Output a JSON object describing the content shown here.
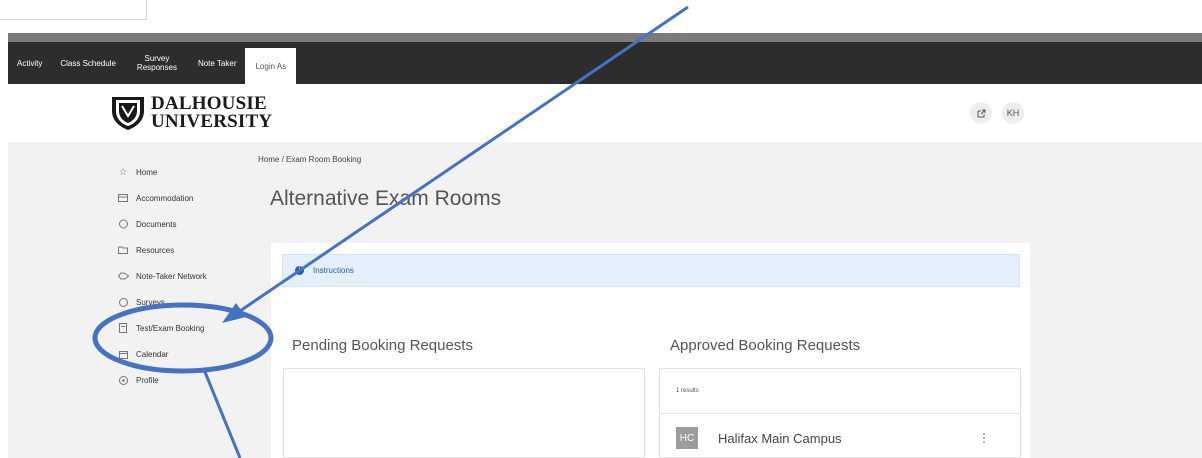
{
  "admin_nav": {
    "tabs": [
      {
        "label": "Activity"
      },
      {
        "label": "Class Schedule"
      },
      {
        "label": "Survey Responses"
      },
      {
        "label": "Note Taker"
      },
      {
        "label": "Login As"
      }
    ]
  },
  "header": {
    "logo_line1": "DALHOUSIE",
    "logo_line2": "UNIVERSITY",
    "icon_right": "KH",
    "icon_left": "external-link-icon"
  },
  "sidebar": {
    "items": [
      {
        "label": "Home",
        "icon": "star-icon"
      },
      {
        "label": "Accommodation",
        "icon": "card-icon"
      },
      {
        "label": "Documents",
        "icon": "document-icon"
      },
      {
        "label": "Resources",
        "icon": "folder-icon"
      },
      {
        "label": "Note-Taker Network",
        "icon": "handshake-icon"
      },
      {
        "label": "Surveys",
        "icon": "survey-icon"
      },
      {
        "label": "Test/Exam Booking",
        "icon": "booking-icon"
      },
      {
        "label": "Calendar",
        "icon": "calendar-icon"
      },
      {
        "label": "Profile",
        "icon": "profile-icon"
      }
    ]
  },
  "breadcrumb": "Home / Exam Room Booking",
  "page_title": "Alternative Exam Rooms",
  "alert": {
    "text": "Instructions"
  },
  "pending": {
    "title": "Pending Booking Requests"
  },
  "approved": {
    "title": "Approved Booking Requests",
    "results": "1 results",
    "items": [
      {
        "initials": "HC",
        "name": "Halifax Main Campus"
      }
    ]
  },
  "colors": {
    "admin_bar": "#2d2d2d",
    "annotation": "#4472c4",
    "alert_bg": "#e3f0fb",
    "content_bg": "#f2f2f2"
  }
}
